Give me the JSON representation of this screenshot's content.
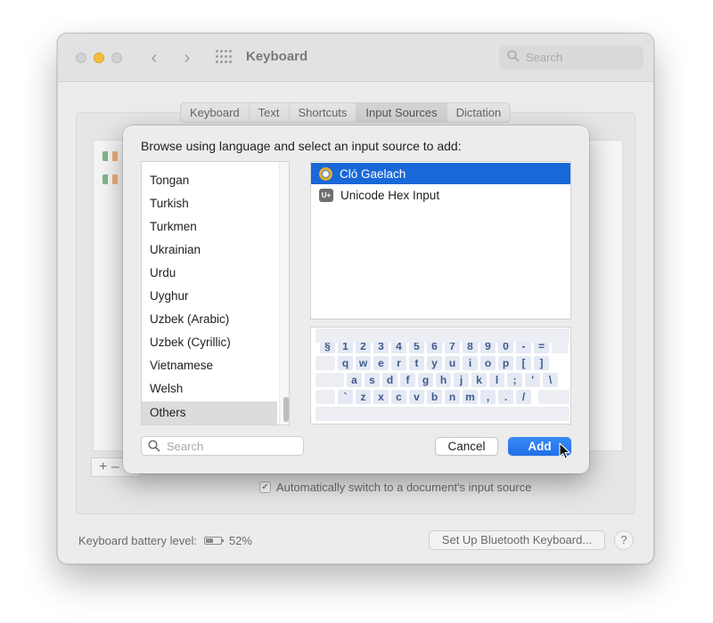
{
  "window": {
    "title": "Keyboard",
    "search_placeholder": "Search",
    "tabs": [
      {
        "label": "Keyboard",
        "active": false
      },
      {
        "label": "Text",
        "active": false
      },
      {
        "label": "Shortcuts",
        "active": false
      },
      {
        "label": "Input Sources",
        "active": true
      },
      {
        "label": "Dictation",
        "active": false
      }
    ],
    "auto_switch_label": "Automatically switch to a document's input source",
    "battery_label": "Keyboard battery level:",
    "battery_value": "52%",
    "battery_level": 0.52,
    "bluetooth_button": "Set Up Bluetooth Keyboard...",
    "help_label": "?",
    "add_remove": "+  –"
  },
  "sheet": {
    "title": "Browse using language and select an input source to add:",
    "languages": [
      "Tongan",
      "Turkish",
      "Turkmen",
      "Ukrainian",
      "Urdu",
      "Uyghur",
      "Uzbek (Arabic)",
      "Uzbek (Cyrillic)",
      "Vietnamese",
      "Welsh",
      "Others"
    ],
    "selected_language": "Others",
    "sources": [
      {
        "label": "Cló Gaelach",
        "icon": "irish-ring-icon",
        "selected": true
      },
      {
        "label": "Unicode Hex Input",
        "icon": "u-plus-icon",
        "selected": false
      }
    ],
    "unicode_badge": "U+",
    "keyboard_rows": [
      [
        "§",
        "1",
        "2",
        "3",
        "4",
        "5",
        "6",
        "7",
        "8",
        "9",
        "0",
        "-",
        "="
      ],
      [
        "q",
        "w",
        "e",
        "r",
        "t",
        "y",
        "u",
        "i",
        "o",
        "p",
        "[",
        "]"
      ],
      [
        "a",
        "s",
        "d",
        "f",
        "g",
        "h",
        "j",
        "k",
        "l",
        ";",
        "'",
        "\\"
      ],
      [
        "`",
        "z",
        "x",
        "c",
        "v",
        "b",
        "n",
        "m",
        ",",
        ".",
        "/"
      ]
    ],
    "search_placeholder": "Search",
    "cancel_label": "Cancel",
    "add_label": "Add"
  },
  "colors": {
    "accent": "#1968d8",
    "minimize": "#f6be3b",
    "key_text": "#3e5a8e"
  }
}
